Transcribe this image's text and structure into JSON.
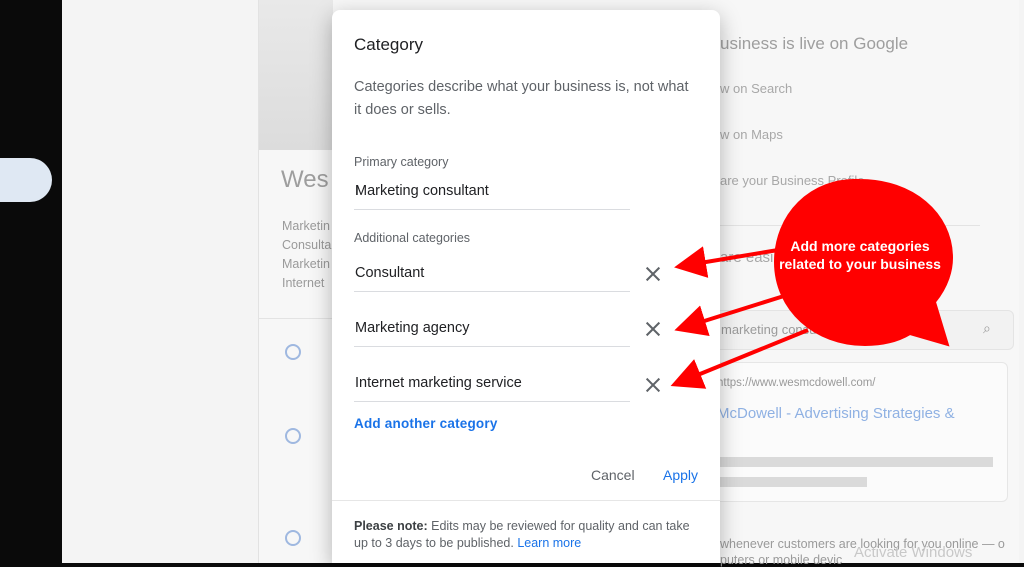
{
  "background": {
    "business_name": "Wes",
    "categories_preview": [
      "Marketin",
      "Consulta",
      "Marketin",
      "Internet"
    ],
    "live_title": "usiness is live on Google",
    "actions": [
      "w on Search",
      "w on Maps",
      "are your Business Profile"
    ],
    "share_text": "are easily in minutes",
    "search_query": "marketing consultant in Chicago",
    "result_url": "https://www.wesmcdowell.com/",
    "result_title": "McDowell - Advertising Strategies &",
    "footer_text": "whenever customers are looking for you online — o",
    "footer_text2": "puters or mobile devic"
  },
  "dialog": {
    "title": "Category",
    "description": "Categories describe what your business is, not what it does or sells.",
    "primary_label": "Primary category",
    "primary_value": "Marketing consultant",
    "additional_label": "Additional categories",
    "additional": [
      {
        "value": "Consultant"
      },
      {
        "value": "Marketing agency"
      },
      {
        "value": "Internet marketing service"
      }
    ],
    "add_link": "Add another category",
    "cancel_label": "Cancel",
    "apply_label": "Apply",
    "note_bold": "Please note:",
    "note_text": " Edits may be reviewed for quality and can take up to 3 days to be published. ",
    "note_link": "Learn more"
  },
  "annotation": {
    "text": "Add more categories related to your business",
    "color": "#ff0000"
  },
  "watermark": "Activate Windows"
}
